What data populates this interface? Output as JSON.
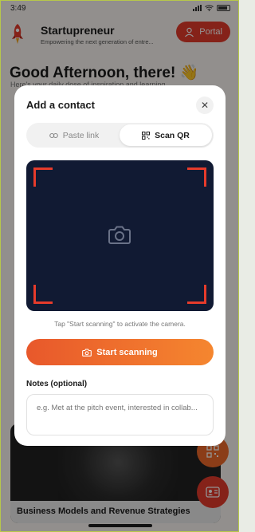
{
  "status_bar": {
    "time": "3:49"
  },
  "header": {
    "app_name": "Startupreneur",
    "tagline": "Empowering the next generation of entre...",
    "portal_label": "Portal"
  },
  "greeting": {
    "title": "Good Afternoon, there! 👋",
    "subtitle": "Here's your daily dose of inspiration and learning"
  },
  "background_card": {
    "caption": "Business Models and Revenue Strategies"
  },
  "modal": {
    "title": "Add a contact",
    "close_icon": "close-icon",
    "tabs": [
      {
        "label": "Paste link",
        "icon": "link-icon",
        "active": false
      },
      {
        "label": "Scan QR",
        "icon": "qr-icon",
        "active": true
      }
    ],
    "camera_hint": "Tap \"Start scanning\" to activate the camera.",
    "start_button_label": "Start scanning",
    "notes": {
      "label": "Notes (optional)",
      "placeholder": "e.g. Met at the pitch event, interested in collab...",
      "value": ""
    }
  },
  "colors": {
    "accent": "#e63b2b",
    "gradient_start": "#e8582b",
    "gradient_end": "#f5862f",
    "camera_bg": "#111a33",
    "page_bg": "#fbf7f3"
  }
}
